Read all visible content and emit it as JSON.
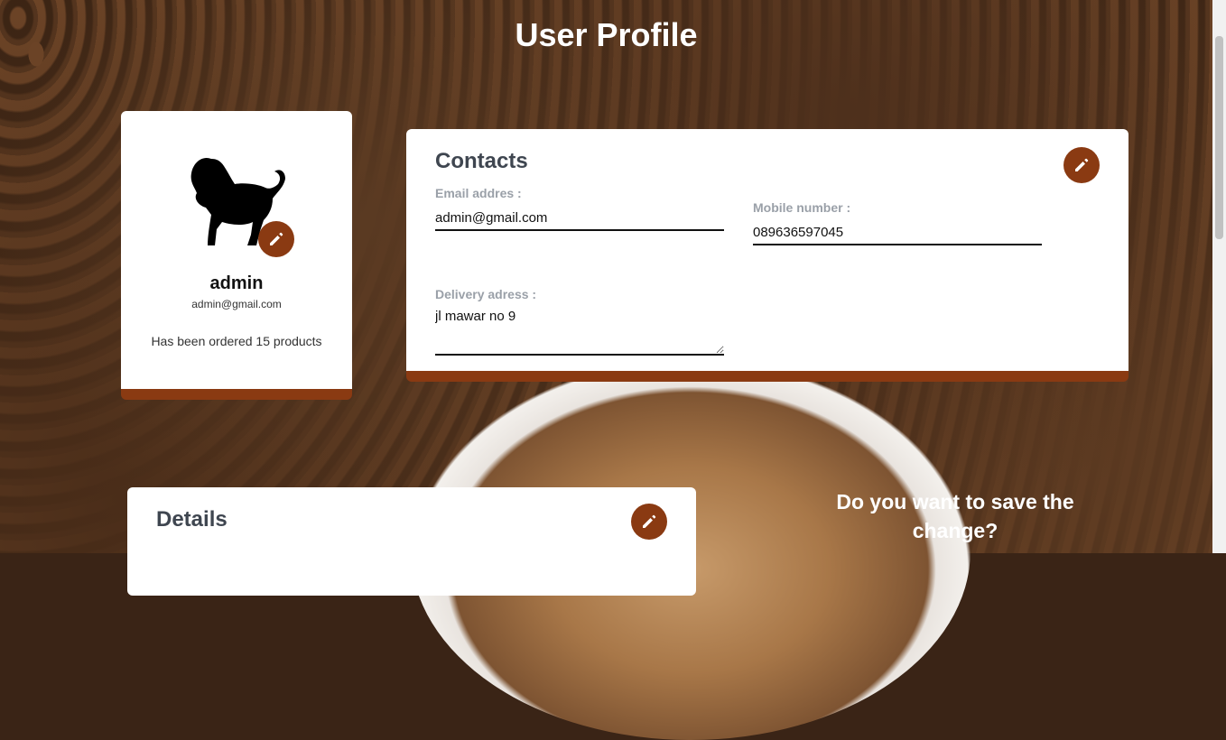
{
  "page": {
    "title": "User Profile"
  },
  "profile": {
    "username": "admin",
    "email": "admin@gmail.com",
    "ordered_text": "Has been ordered 15 products",
    "avatar_icon": "lion-silhouette-icon",
    "edit_icon": "pencil-icon"
  },
  "contacts": {
    "title": "Contacts",
    "email_label": "Email addres :",
    "email_value": "admin@gmail.com",
    "mobile_label": "Mobile number :",
    "mobile_value": "089636597045",
    "delivery_label": "Delivery adress :",
    "delivery_value": "jl mawar no 9",
    "edit_icon": "pencil-icon"
  },
  "details": {
    "title": "Details",
    "edit_icon": "pencil-icon"
  },
  "save_prompt": {
    "text": "Do you want to save the change?"
  },
  "colors": {
    "accent": "#8a3a12",
    "label": "#9aa0a8",
    "heading": "#3f4650"
  }
}
